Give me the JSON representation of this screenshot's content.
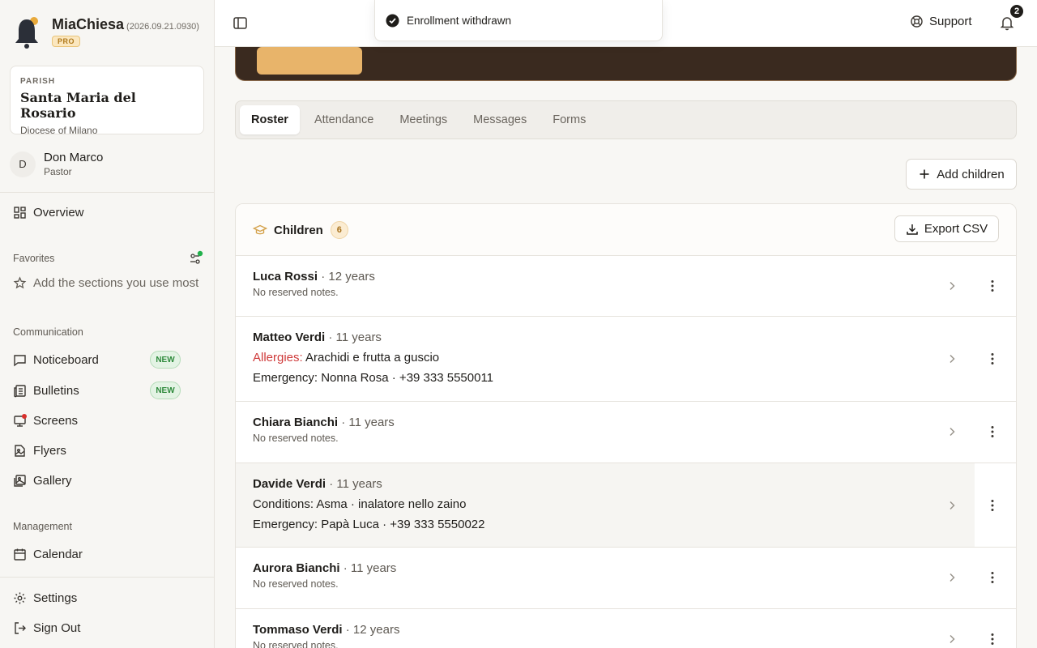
{
  "brand": {
    "name": "MiaChiesa",
    "version": "(2026.09.21.0930)",
    "badge": "PRO"
  },
  "parish": {
    "label": "PARISH",
    "name": "Santa Maria del Rosario",
    "diocese": "Diocese of Milano"
  },
  "user": {
    "initial": "D",
    "name": "Don Marco",
    "role": "Pastor"
  },
  "nav": {
    "overview": "Overview",
    "favorites_label": "Favorites",
    "favorites_placeholder": "Add the sections you use most",
    "communication_label": "Communication",
    "communication": [
      {
        "label": "Noticeboard",
        "badge": "NEW"
      },
      {
        "label": "Bulletins",
        "badge": "NEW"
      },
      {
        "label": "Screens"
      },
      {
        "label": "Flyers"
      },
      {
        "label": "Gallery"
      }
    ],
    "management_label": "Management",
    "calendar": "Calendar",
    "settings": "Settings",
    "sign_out": "Sign Out"
  },
  "topbar": {
    "support": "Support",
    "notifications_count": "2"
  },
  "toast": {
    "message": "Enrollment withdrawn"
  },
  "tabs": [
    "Roster",
    "Attendance",
    "Meetings",
    "Messages",
    "Forms"
  ],
  "active_tab": "Roster",
  "actions": {
    "add_children": "Add children",
    "export_csv": "Export CSV"
  },
  "children_card": {
    "title": "Children",
    "count": "6",
    "rows": [
      {
        "name": "Luca Rossi",
        "age": " · 12 years",
        "note": "No reserved notes."
      },
      {
        "name": "Matteo Verdi",
        "age": " · 11 years",
        "line1_label": "Allergies:",
        "line1_value": " Arachidi e frutta a guscio",
        "line2_label": "Emergency:",
        "line2_value": " Nonna Rosa · +39 333 5550011"
      },
      {
        "name": "Chiara Bianchi",
        "age": " · 11 years",
        "note": "No reserved notes."
      },
      {
        "name": "Davide Verdi",
        "age": " · 11 years",
        "line1_label": "Conditions:",
        "line1_value": " Asma · inalatore nello zaino",
        "line2_label": "Emergency:",
        "line2_value": " Papà Luca · +39 333 5550022"
      },
      {
        "name": "Aurora Bianchi",
        "age": " · 11 years",
        "note": "No reserved notes."
      },
      {
        "name": "Tommaso Verdi",
        "age": " · 12 years",
        "note": "No reserved notes."
      }
    ]
  },
  "colors": {
    "accent": "#e8b46a",
    "hero": "#3a2a1f",
    "allergy": "#cf3a3a",
    "new_badge": "#2f8a3c"
  }
}
